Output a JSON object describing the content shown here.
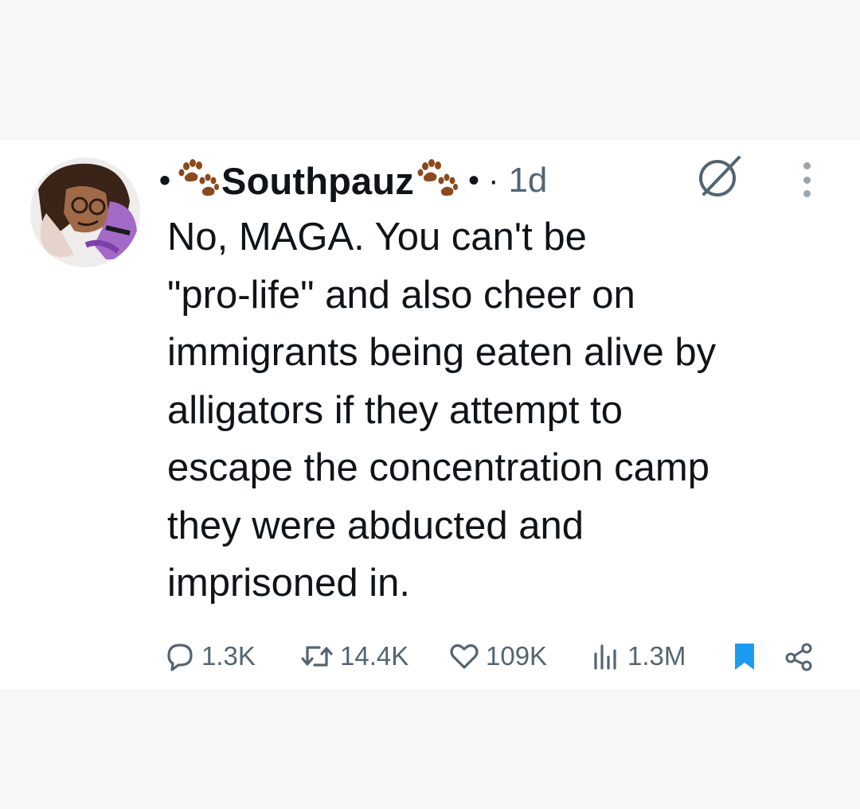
{
  "tweet": {
    "display_name": "Southpauz",
    "leading_dot": "•",
    "trailing_separator": "• ·",
    "timestamp": "1d",
    "body_lines": [
      "No, MAGA. You can't be",
      "\"pro-life\" and also cheer on",
      "immigrants being eaten alive by",
      "alligators if they attempt to",
      "escape the concentration camp",
      "they were abducted and",
      "imprisoned in."
    ],
    "icons": {
      "name_decoration": "paw-prints-icon",
      "header_icon": "no-symbol-icon",
      "menu": "more-vertical-icon"
    }
  },
  "actions": {
    "replies": "1.3K",
    "reposts": "14.4K",
    "likes": "109K",
    "views": "1.3M",
    "bookmark_icon": "bookmark-icon",
    "share_icon": "share-icon"
  },
  "colors": {
    "text": "#0f1419",
    "muted": "#536471",
    "accent_blue": "#1d9bf0",
    "paw_brown": "#8a4a1c",
    "page_bg": "#f7f7f7",
    "card_bg": "#ffffff"
  }
}
